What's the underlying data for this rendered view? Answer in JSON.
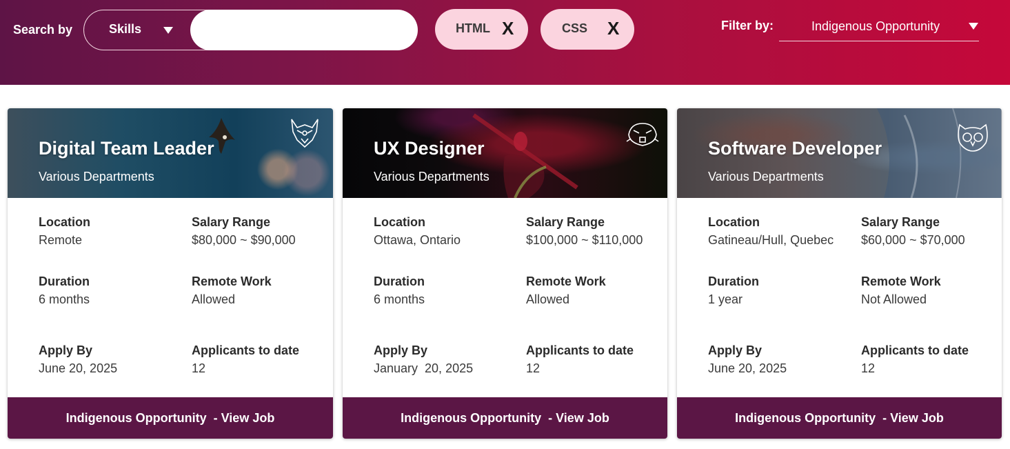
{
  "header": {
    "search_label": "Search by",
    "skills_select": "Skills",
    "search_value": "",
    "chips": [
      {
        "label": "HTML",
        "remove": "X"
      },
      {
        "label": "CSS",
        "remove": "X"
      }
    ],
    "filter_label": "Filter by:",
    "filter_value": "Indigenous Opportunity"
  },
  "labels": {
    "location": "Location",
    "salary": "Salary Range",
    "duration": "Duration",
    "remote": "Remote Work",
    "apply_by": "Apply By",
    "applicants": "Applicants to date"
  },
  "cards": [
    {
      "title": "Digital Team Leader",
      "department": "Various Departments",
      "location": "Remote",
      "salary": "$80,000 ~ $90,000",
      "duration": "6 months",
      "remote": "Allowed",
      "apply_by": "June 20, 2025",
      "applicants": "12",
      "button": "Indigenous Opportunity  - View Job",
      "icon": "wolf-icon"
    },
    {
      "title": "UX Designer",
      "department": "Various Departments",
      "location": "Ottawa, Ontario",
      "salary": "$100,000 ~ $110,000",
      "duration": "6 months",
      "remote": "Allowed",
      "apply_by": "January  20, 2025",
      "applicants": "12",
      "button": "Indigenous Opportunity  - View Job",
      "icon": "beaver-icon"
    },
    {
      "title": "Software Developer",
      "department": "Various Departments",
      "location": "Gatineau/Hull, Quebec",
      "salary": "$60,000 ~ $70,000",
      "duration": "1 year",
      "remote": "Not Allowed",
      "apply_by": "June 20, 2025",
      "applicants": "12",
      "button": "Indigenous Opportunity  - View Job",
      "icon": "owl-icon"
    }
  ],
  "colors": {
    "header_start": "#5e1446",
    "header_end": "#c5083a",
    "chip_bg": "#fbd4df",
    "button_bg": "#5b1645"
  }
}
